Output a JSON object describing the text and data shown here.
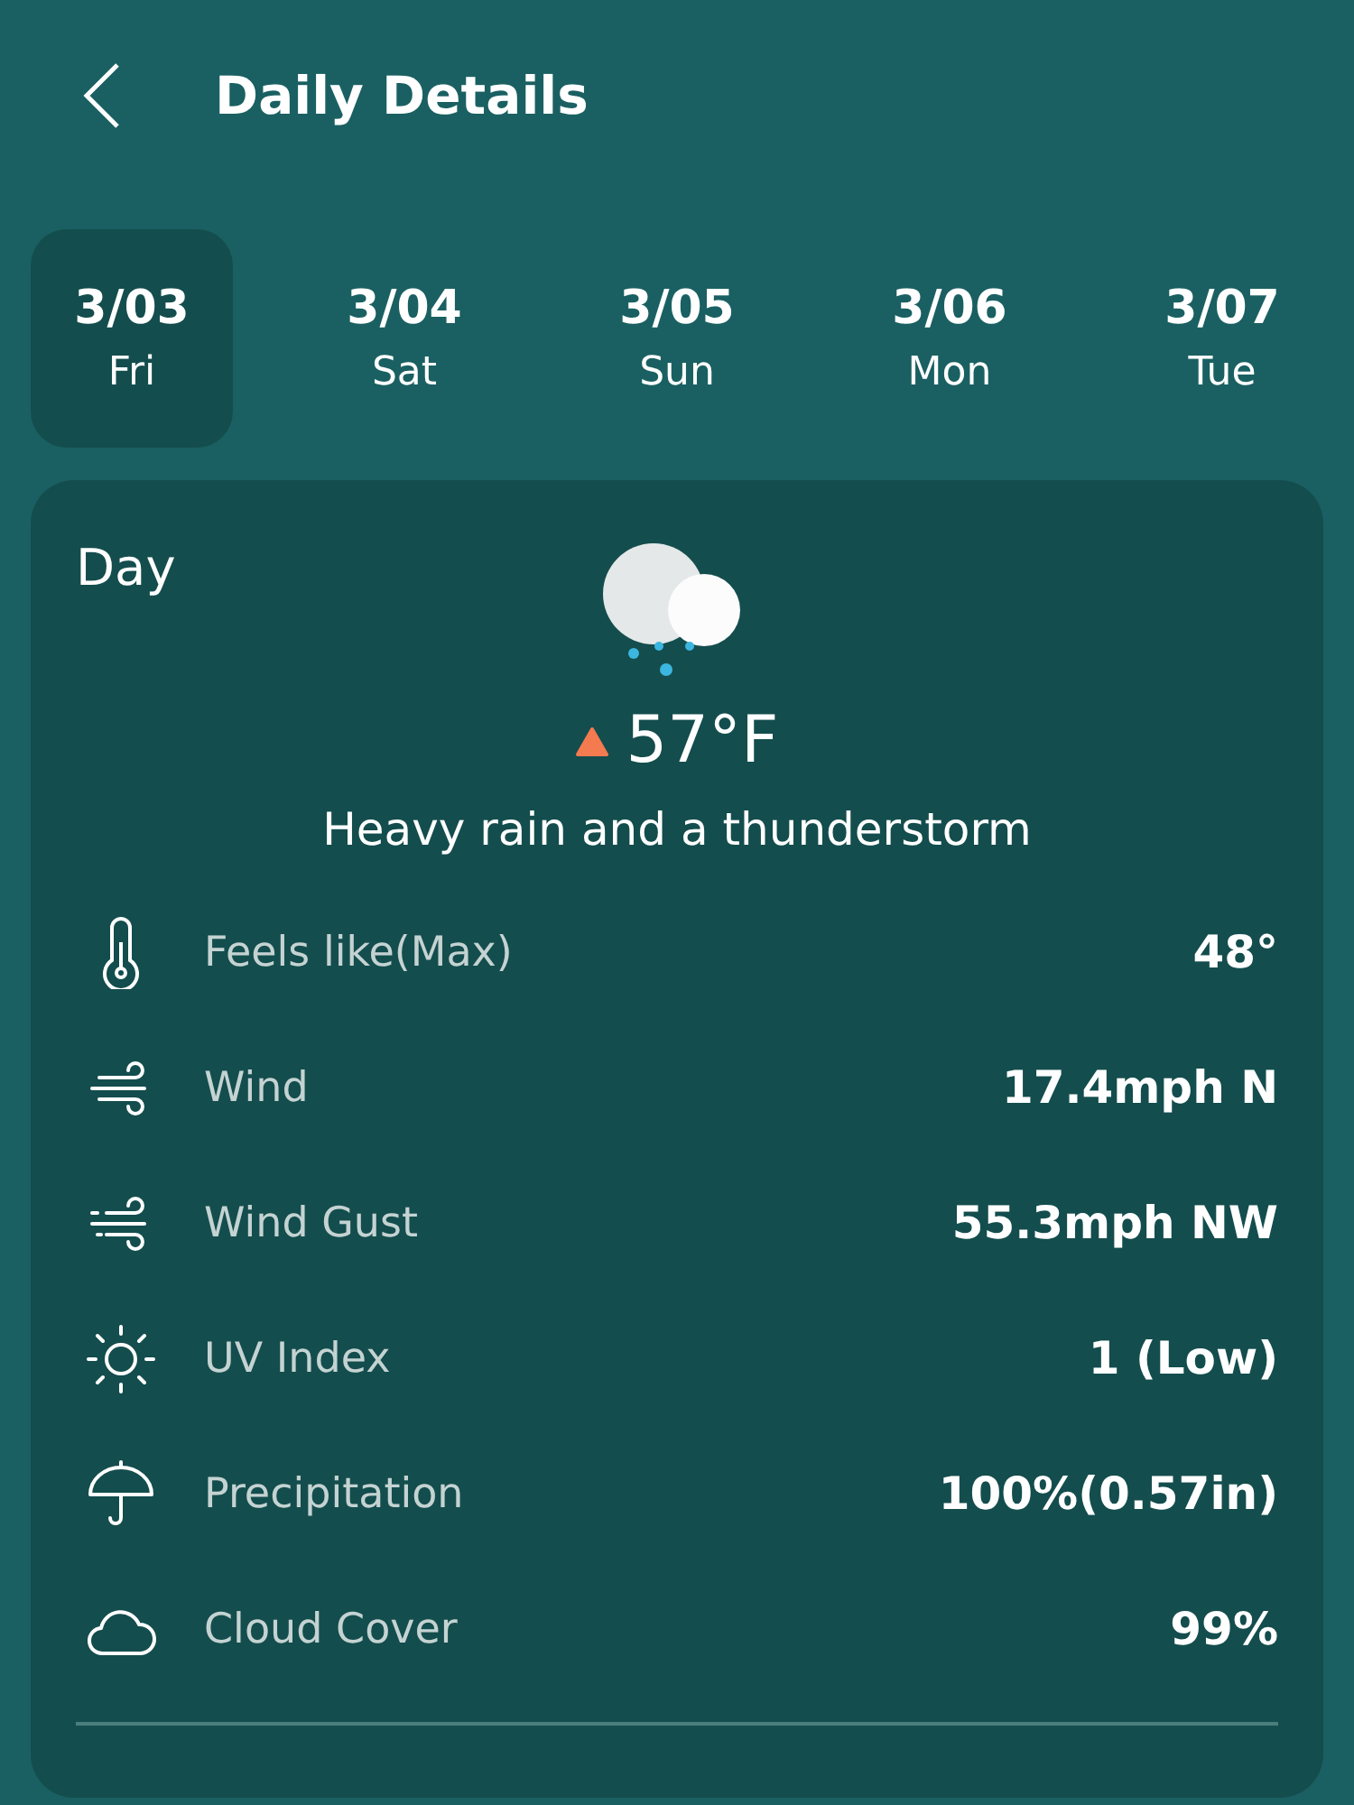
{
  "header": {
    "title": "Daily Details"
  },
  "days": [
    {
      "date": "3/03",
      "weekday": "Fri",
      "selected": true
    },
    {
      "date": "3/04",
      "weekday": "Sat",
      "selected": false
    },
    {
      "date": "3/05",
      "weekday": "Sun",
      "selected": false
    },
    {
      "date": "3/06",
      "weekday": "Mon",
      "selected": false
    },
    {
      "date": "3/07",
      "weekday": "Tue",
      "selected": false
    }
  ],
  "card": {
    "period": "Day",
    "temperature": "57°F",
    "condition": "Heavy rain and a thunderstorm",
    "details": [
      {
        "kind": "thermometer",
        "label": "Feels like(Max)",
        "value": "48°"
      },
      {
        "kind": "wind",
        "label": "Wind",
        "value": "17.4mph N"
      },
      {
        "kind": "gust",
        "label": "Wind Gust",
        "value": "55.3mph NW"
      },
      {
        "kind": "uv",
        "label": "UV Index",
        "value": "1 (Low)"
      },
      {
        "kind": "umbrella",
        "label": "Precipitation",
        "value": "100%(0.57in)"
      },
      {
        "kind": "cloud",
        "label": "Cloud Cover",
        "value": "99%"
      }
    ]
  }
}
